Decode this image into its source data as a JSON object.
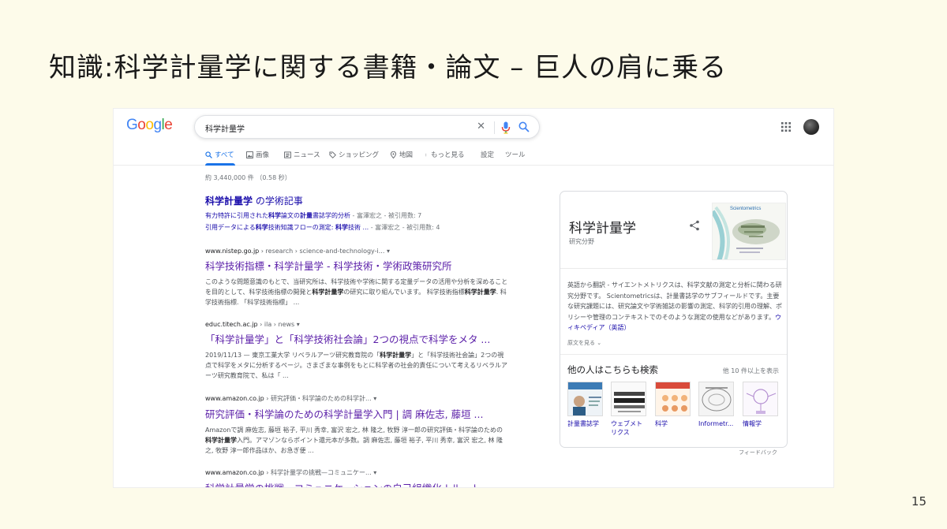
{
  "slide": {
    "title": "知識:科学計量学に関する書籍・論文 – 巨人の肩に乗る",
    "page_number": "15"
  },
  "google": {
    "logo_letters": [
      {
        "ch": "G",
        "color": "#4285F4"
      },
      {
        "ch": "o",
        "color": "#EA4335"
      },
      {
        "ch": "o",
        "color": "#FBBC05"
      },
      {
        "ch": "g",
        "color": "#4285F4"
      },
      {
        "ch": "l",
        "color": "#34A853"
      },
      {
        "ch": "e",
        "color": "#EA4335"
      }
    ],
    "search": {
      "query": "科学計量学",
      "clear_glyph": "✕"
    },
    "tabs": [
      {
        "label": "すべて",
        "icon": "search-icon",
        "active": true
      },
      {
        "label": "画像",
        "icon": "image-icon"
      },
      {
        "label": "ニュース",
        "icon": "news-icon"
      },
      {
        "label": "ショッピング",
        "icon": "tag-icon"
      },
      {
        "label": "地図",
        "icon": "map-pin-icon"
      },
      {
        "label": "もっと見る",
        "icon": "more-vert-icon"
      },
      {
        "label": "設定"
      },
      {
        "label": "ツール"
      }
    ],
    "stats": "約 3,440,000 件 （0.58 秒）",
    "scholar": {
      "title_bold": "科学計量学",
      "title_rest": " の学術記事",
      "items": [
        {
          "pre": "有力特許に引用された",
          "bold1": "科学",
          "mid": "論文の",
          "bold2": "計量",
          "post": "書誌学的分析",
          "meta": " - 富澤宏之 - 被引用数: 7"
        },
        {
          "pre": "引用データによる",
          "bold1": "科学",
          "mid": "技術知識フローの測定: ",
          "bold2": "科学",
          "post": "技術 ...",
          "meta": " - 富澤宏之 - 被引用数: 4"
        }
      ]
    },
    "results": [
      {
        "domain": "www.nistep.go.jp",
        "path": " › research › science-and-technology-i...",
        "title": "科学技術指標・科学計量学 - 科学技術・学術政策研究所",
        "snippet": "このような問題意識のもとで、当研究所は、科学技術や学術に関する定量データの活用や分析を深めることを目的として、科学技術指標の開発と科学計量学の研究に取り組んでいます。 科学技術指標科学計量学. 科学技術指標. 「科学技術指標」 ..."
      },
      {
        "domain": "educ.titech.ac.jp",
        "path": " › ila › news",
        "title": "「科学計量学」と「科学技術社会論」2つの視点で科学をメタ ...",
        "snippet": "2019/11/13 — 東京工業大学 リベラルアーツ研究教育院の「科学計量学」と「科学技術社会論」2つの視点で科学をメタに分析するページ。さまざまな事例をもとに科学者の社会的責任について考えるリベラルアーツ研究教育院で、私は「 ..."
      },
      {
        "domain": "www.amazon.co.jp",
        "path": " › 研究評価・科学論のための科学計...",
        "title": "研究評価・科学論のための科学計量学入門 | 調 麻佐志, 藤垣 ...",
        "snippet": "Amazonで調 麻佐志, 藤垣 裕子, 平川 秀幸, 富沢 宏之, 林 隆之, 牧野 淳一郎の研究評価・科学論のための科学計量学入門。アマゾンならポイント還元本が多数。調 麻佐志, 藤垣 裕子, 平川 秀幸, 富沢 宏之, 林 隆之, 牧野 淳一郎作品ほか、お急ぎ便 ..."
      },
      {
        "domain": "www.amazon.co.jp",
        "path": " › 科学計量学の挑戦—コミュニケー...",
        "title": "科学計量学の挑戦—コミュニケーションの自己組織化 | ルート ...",
        "snippet": ""
      }
    ],
    "knowledge_panel": {
      "title": "科学計量学",
      "subtitle": "研究分野",
      "image_caption": "Scientometrics",
      "description": "英語から翻訳 - サイエントメトリクスは、科学文献の測定と分析に関わる研究分野です。 Scientometricsは、計量書誌学のサブフィールドです。主要な研究課題には、研究論文や学術雑誌の影響の測定、科学的引用の理解、ポリシーや管理のコンテキストでのそのような測定の使用などがあります。",
      "wiki_link": "ウィキペディア（英語）",
      "original_link": "原文を見る",
      "also_search_title": "他の人はこちらも検索",
      "also_search_more": "他 10 件以上を表示",
      "also_search": [
        {
          "label": "計量書誌学"
        },
        {
          "label": "ウェブメトリクス"
        },
        {
          "label": "科学"
        },
        {
          "label": "Informetr..."
        },
        {
          "label": "情報学"
        }
      ],
      "feedback": "フィードバック"
    }
  }
}
